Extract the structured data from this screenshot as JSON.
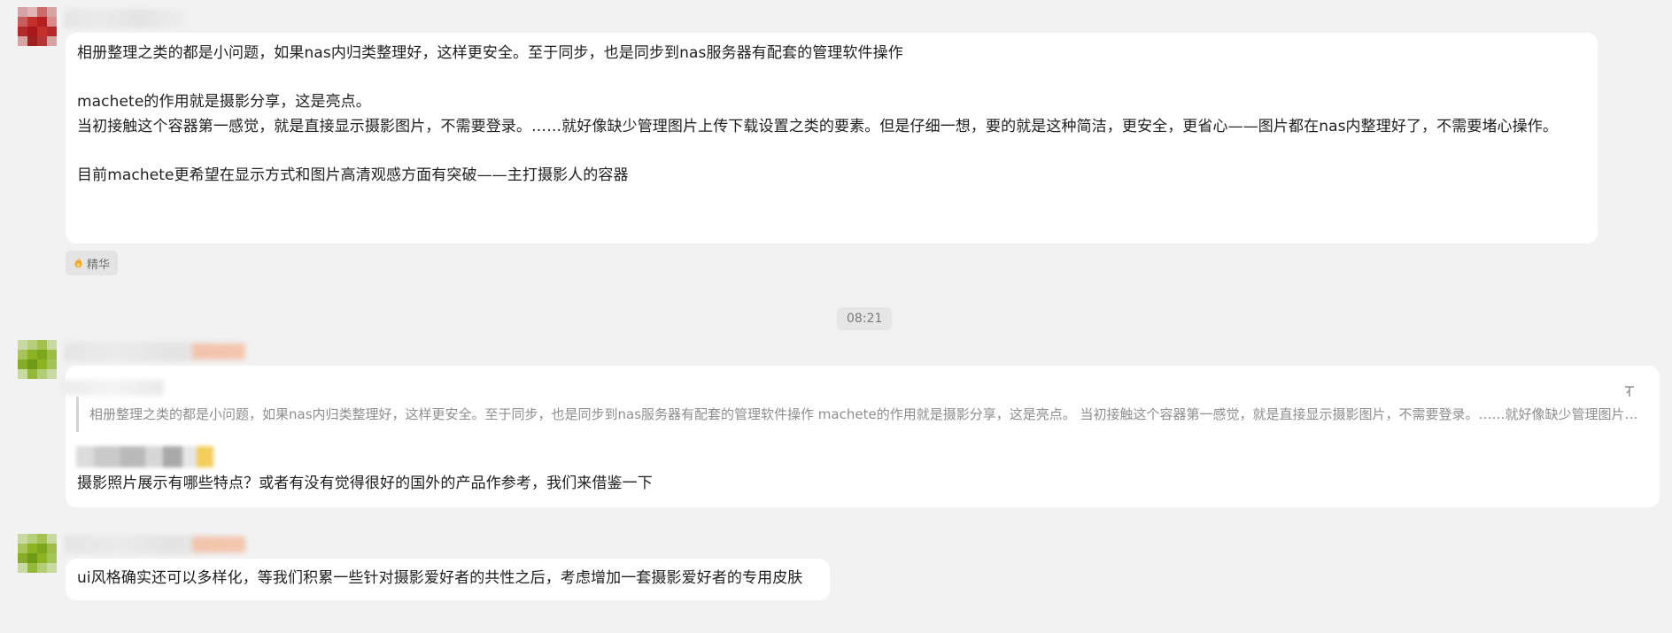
{
  "messages": [
    {
      "text": "相册整理之类的都是小问题，如果nas内归类整理好，这样更安全。至于同步，也是同步到nas服务器有配套的管理软件操作\n\nmachete的作用就是摄影分享，这是亮点。\n当初接触这个容器第一感觉，就是直接显示摄影图片，不需要登录。……就好像缺少管理图片上传下载设置之类的要素。但是仔细一想，要的就是这种简洁，更安全，更省心——图片都在nas内整理好了，不需要堵心操作。\n\n目前machete更希望在显示方式和图片高清观感方面有突破——主打摄影人的容器",
      "badge": "精华"
    },
    {
      "quote": "相册整理之类的都是小问题，如果nas内归类整理好，这样更安全。至于同步，也是同步到nas服务器有配套的管理软件操作 machete的作用就是摄影分享，这是亮点。 当初接触这个容器第一感觉，就是直接显示摄影图片，不需要登录。……就好像缺少管理图片上...",
      "text": "摄影照片展示有哪些特点？或者有没有觉得很好的国外的产品作参考，我们来借鉴一下"
    },
    {
      "text": "ui风格确实还可以多样化，等我们积累一些针对摄影爱好者的共性之后，考虑增加一套摄影爱好者的专用皮肤"
    }
  ],
  "timestamp": "08:21",
  "icons": {
    "badge": "flame-icon",
    "pin": "pin-to-top-icon"
  },
  "colors": {
    "background": "#f2f2f2",
    "bubble": "#ffffff",
    "badge_flame": "#f5a623",
    "tag_orange": "#f7b38f",
    "avatar_red": "#c4302b",
    "avatar_green": "#8cb322"
  }
}
